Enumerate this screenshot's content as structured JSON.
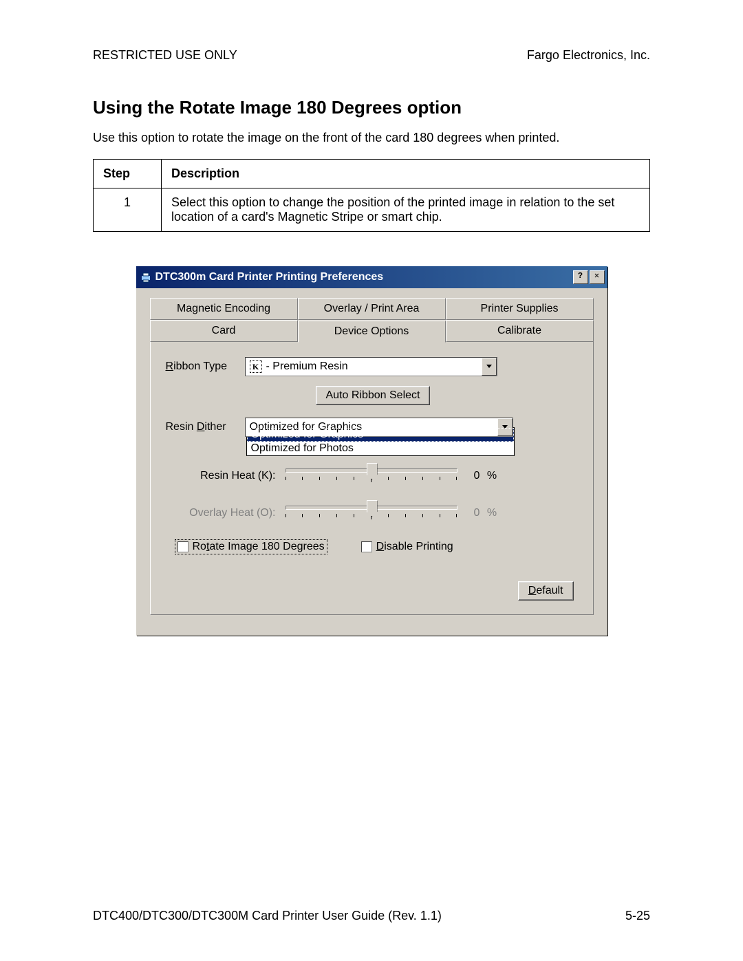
{
  "header": {
    "left": "RESTRICTED USE ONLY",
    "right": "Fargo Electronics, Inc."
  },
  "section": {
    "title": "Using the Rotate Image 180 Degrees option",
    "intro": "Use this option to rotate the image on the front of the card 180 degrees when printed."
  },
  "table": {
    "col_step": "Step",
    "col_desc": "Description",
    "rows": [
      {
        "step": "1",
        "desc": "Select this option to change the position of the printed image in relation to the set location of a card's Magnetic Stripe or smart chip."
      }
    ]
  },
  "dialog": {
    "title": "DTC300m Card Printer Printing Preferences",
    "help_btn": "?",
    "close_btn": "✕",
    "tabs_back": [
      "Magnetic Encoding",
      "Overlay / Print Area",
      "Printer Supplies"
    ],
    "tabs_front": [
      "Card",
      "Device Options",
      "Calibrate"
    ],
    "selected_tab_index": 1,
    "ribbon_type_label": "Ribbon Type",
    "ribbon_type_value": " - Premium Resin",
    "ribbon_type_icon_letter": "K",
    "auto_ribbon_btn": "Auto Ribbon Select",
    "resin_dither_label": "Resin Dither",
    "resin_dither_value": "Optimized for Graphics",
    "resin_dither_options": [
      "Optimized for Graphics",
      "Optimized for Photos"
    ],
    "resin_dither_highlight_index": 0,
    "resin_heat_label": "Resin Heat  (K):",
    "resin_heat_value": "0 %",
    "overlay_heat_label": "Overlay Heat  (O):",
    "overlay_heat_value": "0 %",
    "rotate_label": "Rotate Image 180 Degrees",
    "disable_label": "Disable Printing",
    "default_btn": "Default"
  },
  "footer": {
    "left": "DTC400/DTC300/DTC300M Card Printer User Guide (Rev. 1.1)",
    "right": "5-25"
  }
}
